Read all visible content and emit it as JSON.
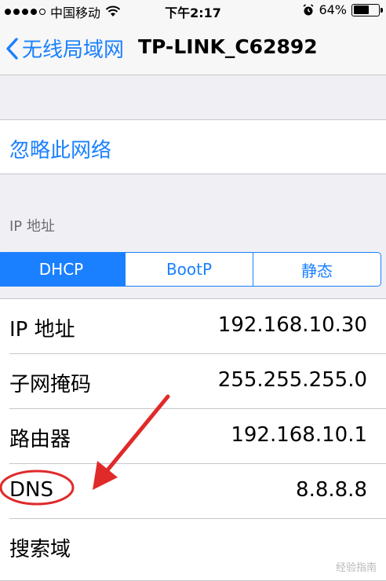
{
  "status_bar": {
    "carrier": "中国移动",
    "time": "下午2:17",
    "battery_percent": "64%",
    "battery_level": 0.64,
    "icons": [
      "signal-dots-icon",
      "wifi-icon",
      "alarm-icon",
      "battery-icon"
    ]
  },
  "nav": {
    "back_label": "无线局域网",
    "title": "TP-LINK_C62892"
  },
  "forget_label": "忽略此网络",
  "ip_section_header": "IP 地址",
  "segments": {
    "options": [
      "DHCP",
      "BootP",
      "静态"
    ],
    "selected": "DHCP"
  },
  "rows": [
    {
      "label": "IP 地址",
      "value": "192.168.10.30"
    },
    {
      "label": "子网掩码",
      "value": "255.255.255.0"
    },
    {
      "label": "路由器",
      "value": "192.168.10.1"
    },
    {
      "label": "DNS",
      "value": "8.8.8.8"
    },
    {
      "label": "搜索域",
      "value": ""
    }
  ],
  "colors": {
    "accent": "#1a80ff",
    "annotation": "#e02a2a",
    "background": "#efeff4"
  },
  "watermark": "经验指南"
}
